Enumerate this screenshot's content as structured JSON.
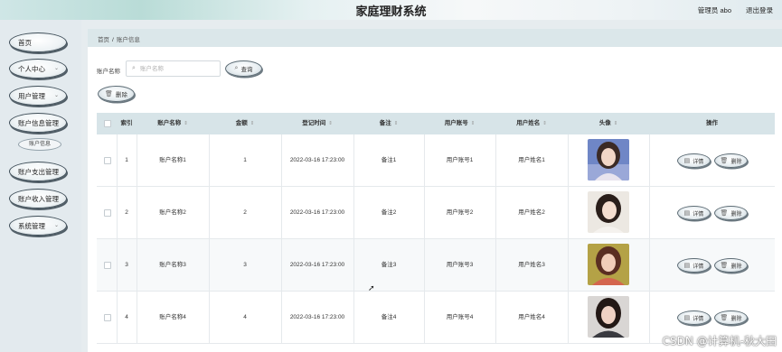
{
  "header": {
    "title": "家庭理财系统",
    "admin": "管理员 abo",
    "logout": "退出登录"
  },
  "sidebar": {
    "items": [
      {
        "label": "首页",
        "chevron": false
      },
      {
        "label": "个人中心",
        "chevron": true
      },
      {
        "label": "用户管理",
        "chevron": true
      },
      {
        "label": "账户信息管理",
        "chevron": false
      },
      {
        "label": "账户支出管理",
        "chevron": false
      },
      {
        "label": "账户收入管理",
        "chevron": false
      },
      {
        "label": "系统管理",
        "chevron": true
      }
    ],
    "submenu": {
      "label": "账户信息"
    }
  },
  "breadcrumb": {
    "home": "首页",
    "sep": "/",
    "current": "账户信息"
  },
  "search": {
    "label": "账户名称",
    "placeholder": "账户名称",
    "value": "",
    "button": "查询"
  },
  "toolbar": {
    "delete_label": "删除"
  },
  "table": {
    "columns": [
      "索引",
      "账户名称",
      "金额",
      "登记时间",
      "备注",
      "用户账号",
      "用户姓名",
      "头像",
      "操作"
    ],
    "rows": [
      {
        "index": "1",
        "name": "账户名称1",
        "amount": "1",
        "time": "2022-03-16 17:23:00",
        "note": "备注1",
        "account": "用户账号1",
        "username": "用户姓名1"
      },
      {
        "index": "2",
        "name": "账户名称2",
        "amount": "2",
        "time": "2022-03-16 17:23:00",
        "note": "备注2",
        "account": "用户账号2",
        "username": "用户姓名2"
      },
      {
        "index": "3",
        "name": "账户名称3",
        "amount": "3",
        "time": "2022-03-16 17:23:00",
        "note": "备注3",
        "account": "用户账号3",
        "username": "用户姓名3"
      },
      {
        "index": "4",
        "name": "账户名称4",
        "amount": "4",
        "time": "2022-03-16 17:23:00",
        "note": "备注4",
        "account": "用户账号4",
        "username": "用户姓名4"
      }
    ],
    "actions": {
      "detail": "详情",
      "delete": "删除"
    }
  },
  "watermark": "CSDN @计算机-秋大田",
  "colors": {
    "sidebar_bg": "#e3eaee",
    "header_bar": "#dbe7ea",
    "table_head": "#d7e4e8",
    "button_border": "#5c6b74"
  },
  "icons": {
    "search": "search-icon",
    "delete": "trash-icon",
    "detail": "document-icon",
    "sort": "sort-icon"
  }
}
